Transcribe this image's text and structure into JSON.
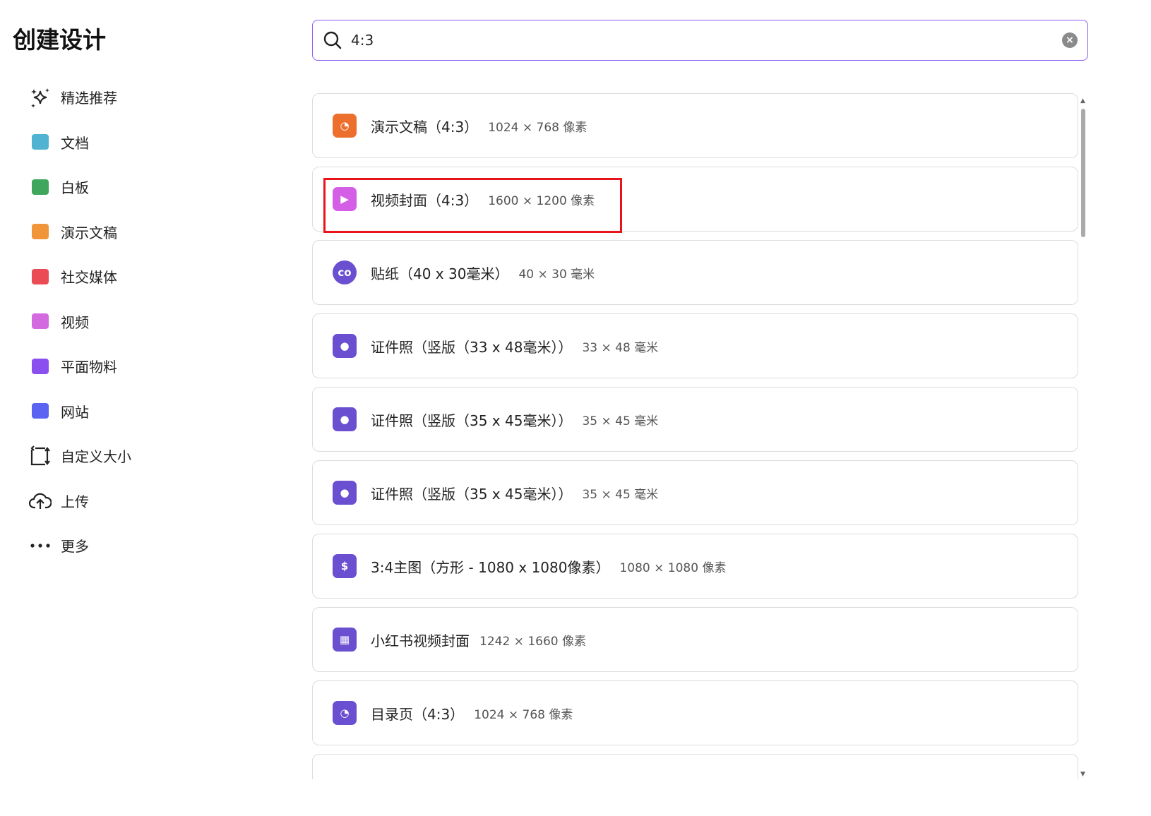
{
  "title": "创建设计",
  "nav": [
    {
      "label": "精选推荐",
      "icon": "sparkles-icon"
    },
    {
      "label": "文档",
      "icon": "doc-icon",
      "color": "#4fb3d1"
    },
    {
      "label": "白板",
      "icon": "whiteboard-icon",
      "color": "#3fa65e"
    },
    {
      "label": "演示文稿",
      "icon": "presentation-icon",
      "color": "#f0953a"
    },
    {
      "label": "社交媒体",
      "icon": "heart-icon",
      "color": "#ea4b55"
    },
    {
      "label": "视频",
      "icon": "video-icon",
      "color": "#d46ae0"
    },
    {
      "label": "平面物料",
      "icon": "printer-icon",
      "color": "#8b4ff0"
    },
    {
      "label": "网站",
      "icon": "website-icon",
      "color": "#5a63f2"
    },
    {
      "label": "自定义大小",
      "icon": "resize-icon"
    },
    {
      "label": "上传",
      "icon": "upload-cloud-icon"
    },
    {
      "label": "更多",
      "icon": "more-icon"
    }
  ],
  "search": {
    "value": "4:3",
    "clear": "×"
  },
  "results": [
    {
      "name": "演示文稿（4:3）",
      "dims": "1024 × 768 像素",
      "icon": "presentation-icon",
      "color": "#ec6f2d",
      "glyph": "◔"
    },
    {
      "name": "视频封面（4:3）",
      "dims": "1600 × 1200 像素",
      "icon": "video-icon",
      "color": "#d55ee6",
      "glyph": "▶"
    },
    {
      "name": "贴纸（40 x 30毫米）",
      "dims": "40 × 30 毫米",
      "icon": "sticker-icon",
      "color": "#6a4fd0",
      "glyph": "co"
    },
    {
      "name": "证件照（竖版（33 x 48毫米））",
      "dims": "33 × 48 毫米",
      "icon": "id-photo-icon",
      "color": "#6a4fd0",
      "glyph": "●"
    },
    {
      "name": "证件照（竖版（35 x 45毫米））",
      "dims": "35 × 45 毫米",
      "icon": "id-photo-icon",
      "color": "#6a4fd0",
      "glyph": "●"
    },
    {
      "name": "证件照（竖版（35 x 45毫米））",
      "dims": "35 × 45 毫米",
      "icon": "id-photo-icon",
      "color": "#6a4fd0",
      "glyph": "●"
    },
    {
      "name": "3:4主图（方形 - 1080 x 1080像素）",
      "dims": "1080 × 1080 像素",
      "icon": "product-image-icon",
      "color": "#6a4fd0",
      "glyph": "$"
    },
    {
      "name": "小红书视频封面",
      "dims": "1242 × 1660 像素",
      "icon": "layout-icon",
      "color": "#6a4fd0",
      "glyph": "▦"
    },
    {
      "name": "目录页（4:3）",
      "dims": "1024 × 768 像素",
      "icon": "presentation-icon",
      "color": "#6a4fd0",
      "glyph": "◔"
    }
  ]
}
